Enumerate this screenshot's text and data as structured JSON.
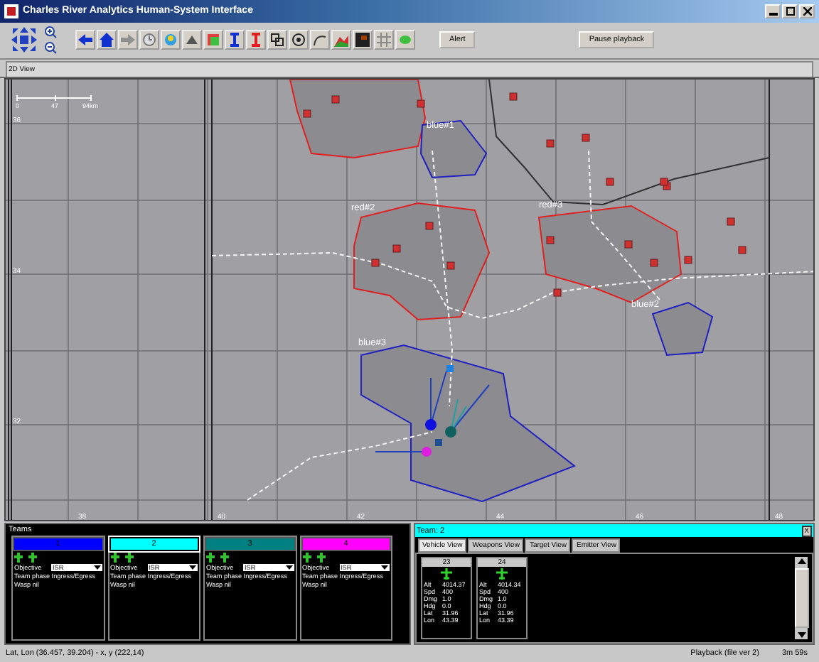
{
  "window": {
    "title": "Charles River Analytics Human-System Interface"
  },
  "toolbar": {
    "buttons": [
      "Alert",
      "Pause playback"
    ]
  },
  "tabs": [
    {
      "label": "2D View",
      "selected": true
    }
  ],
  "map": {
    "scale_labels": [
      "0",
      "47",
      "94km"
    ],
    "lat_labels": [
      "36",
      "34",
      "32"
    ],
    "lon_labels": [
      "38",
      "40",
      "42",
      "44",
      "46",
      "48"
    ],
    "areas": [
      {
        "color": "#e02020"
      },
      {
        "label": "blue#1",
        "color": "#2020c0"
      },
      {
        "label": "red#2",
        "color": "#e02020"
      },
      {
        "label": "red#3",
        "color": "#e02020"
      },
      {
        "label": "blue#2",
        "color": "#2020c0"
      },
      {
        "label": "blue#3",
        "color": "#2020c0"
      }
    ]
  },
  "teams_panel": {
    "title": "Teams",
    "teams": [
      {
        "number": "1",
        "color": "#0000ff",
        "selected": false,
        "objective_label": "Objective",
        "objective": "ISR",
        "phase": "Team phase Ingress/Egress",
        "wasp": "Wasp nil"
      },
      {
        "number": "2",
        "color": "#00ffff",
        "selected": true,
        "objective_label": "Objective",
        "objective": "ISR",
        "phase": "Team phase Ingress/Egress",
        "wasp": "Wasp nil"
      },
      {
        "number": "3",
        "color": "#008080",
        "selected": false,
        "objective_label": "Objective",
        "objective": "ISR",
        "phase": "Team phase Ingress/Egress",
        "wasp": "Wasp nil"
      },
      {
        "number": "4",
        "color": "#ff00ff",
        "selected": false,
        "objective_label": "Objective",
        "objective": "ISR",
        "phase": "Team phase Ingress/Egress",
        "wasp": "Wasp nil"
      }
    ]
  },
  "team_panel": {
    "title": "Team: 2",
    "color": "#00ffff",
    "close": "X",
    "tabs": [
      {
        "label": "Vehicle View",
        "selected": true
      },
      {
        "label": "Weapons View",
        "selected": false
      },
      {
        "label": "Target View",
        "selected": false
      },
      {
        "label": "Emitter View",
        "selected": false
      }
    ],
    "vehicles": [
      {
        "id": "23",
        "fields": [
          {
            "label": "Alt",
            "value": "4014.37"
          },
          {
            "label": "Spd",
            "value": "400"
          },
          {
            "label": "Dmg",
            "value": "1.0"
          },
          {
            "label": "Hdg",
            "value": "0.0"
          },
          {
            "label": "Lat",
            "value": "31.96"
          },
          {
            "label": "Lon",
            "value": "43.39"
          }
        ]
      },
      {
        "id": "24",
        "fields": [
          {
            "label": "Alt",
            "value": "4014.34"
          },
          {
            "label": "Spd",
            "value": "400"
          },
          {
            "label": "Dmg",
            "value": "1.0"
          },
          {
            "label": "Hdg",
            "value": "0.0"
          },
          {
            "label": "Lat",
            "value": "31.96"
          },
          {
            "label": "Lon",
            "value": "43.39"
          }
        ]
      }
    ]
  },
  "status_bar": {
    "position": "Lat, Lon (36.457, 39.204) - x, y (222,14)",
    "mode": "Playback (file ver 2)",
    "time": "3m 59s"
  }
}
